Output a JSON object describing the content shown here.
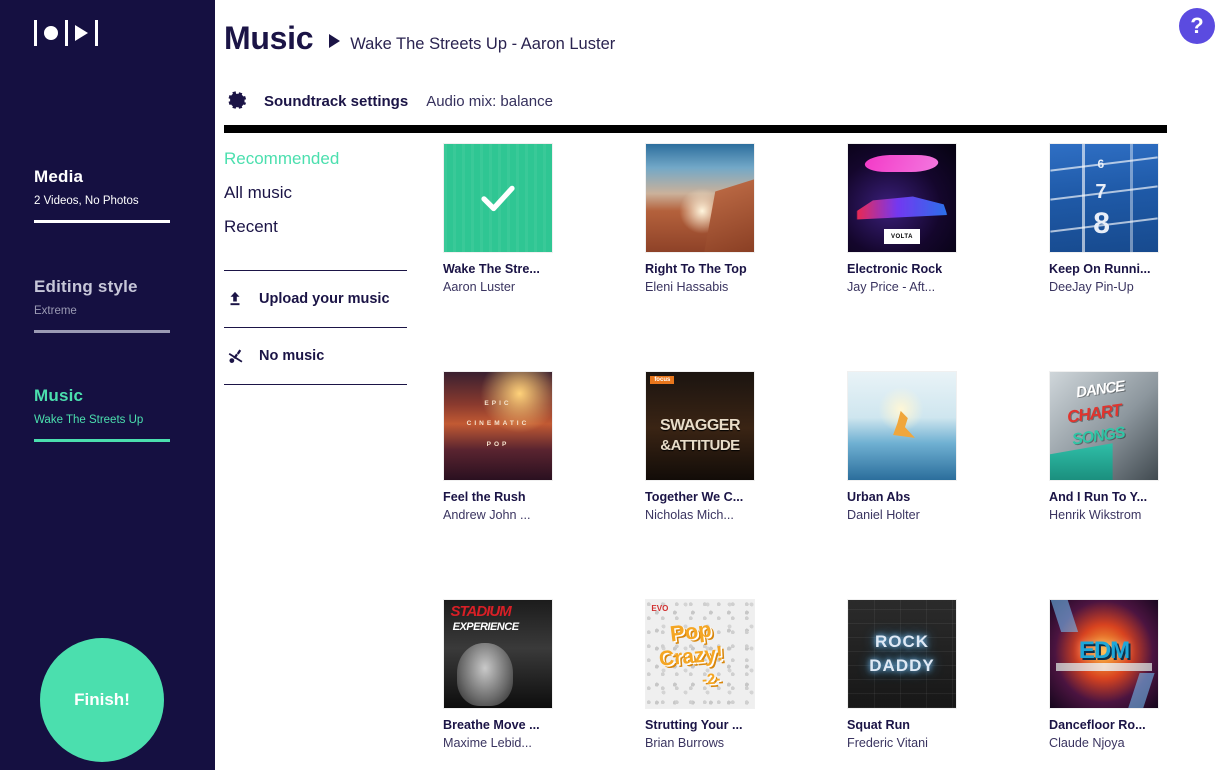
{
  "sidebar": {
    "logo_name": "record-play-logo",
    "sections": [
      {
        "id": "media",
        "title": "Media",
        "subtitle": "2 Videos, No Photos"
      },
      {
        "id": "style",
        "title": "Editing style",
        "subtitle": "Extreme"
      },
      {
        "id": "music",
        "title": "Music",
        "subtitle": "Wake The Streets Up"
      }
    ],
    "finish_label": "Finish!",
    "accent_color": "#4bdfae",
    "background_color": "#151041"
  },
  "header": {
    "title": "Music",
    "track_caption": "Wake The Streets Up - Aaron Luster",
    "help_label": "?",
    "help_color": "#5b4be0"
  },
  "settings": {
    "label": "Soundtrack settings",
    "audio_mix": "Audio mix: balance"
  },
  "categories": [
    {
      "label": "Recommended",
      "active": true
    },
    {
      "label": "All music",
      "active": false
    },
    {
      "label": "Recent",
      "active": false
    }
  ],
  "actions": [
    {
      "label": "Upload your music",
      "icon": "upload-icon"
    },
    {
      "label": "No music",
      "icon": "music-note-off-icon"
    }
  ],
  "tracks": [
    {
      "title": "Wake The Stre...",
      "artist": "Aaron Luster",
      "art": "art-selected",
      "selected": true
    },
    {
      "title": "Right To The Top",
      "artist": "Eleni Hassabis",
      "art": "art-cliff",
      "selected": false
    },
    {
      "title": "Electronic Rock",
      "artist": "Jay Price - Aft...",
      "art": "art-neon",
      "selected": false
    },
    {
      "title": "Keep On Runni...",
      "artist": "DeeJay Pin-Up",
      "art": "art-track",
      "selected": false
    },
    {
      "title": "Feel the Rush",
      "artist": "Andrew John ...",
      "art": "art-epic",
      "selected": false
    },
    {
      "title": "Together We C...",
      "artist": "Nicholas Mich...",
      "art": "art-swag",
      "selected": false
    },
    {
      "title": "Urban Abs",
      "artist": "Daniel Holter",
      "art": "art-surf",
      "selected": false
    },
    {
      "title": "And I Run To Y...",
      "artist": "Henrik Wikstrom",
      "art": "art-dance",
      "selected": false
    },
    {
      "title": "Breathe Move ...",
      "artist": "Maxime Lebid...",
      "art": "art-stad",
      "selected": false
    },
    {
      "title": "Strutting Your ...",
      "artist": "Brian Burrows",
      "art": "art-pop",
      "selected": false
    },
    {
      "title": "Squat Run",
      "artist": "Frederic Vitani",
      "art": "art-rock",
      "selected": false
    },
    {
      "title": "Dancefloor Ro...",
      "artist": "Claude Njoya",
      "art": "art-edm",
      "selected": false
    }
  ],
  "artwork_text": {
    "neon_badge": "VOLTA",
    "epic_line1": "EPIC",
    "epic_line2": "CINEMATIC",
    "epic_line3": "POP",
    "swag_tag": "focus",
    "swag_line1": "SWAGGER",
    "swag_line2": "&ATTITUDE",
    "dance_line1": "DANCE",
    "dance_line2": "CHART",
    "dance_line3": "SONGS",
    "stadium_line1": "STADIUM",
    "stadium_line2": "EXPERIENCE",
    "pop_tag": "EVO",
    "pop_line1": "Pop",
    "pop_line2": "Crazy!",
    "pop_line3": "-2-",
    "rock_line1": "ROCK",
    "rock_line2": "DADDY",
    "edm_line1": "EDM",
    "track_nums": [
      "6",
      "7",
      "8"
    ]
  }
}
